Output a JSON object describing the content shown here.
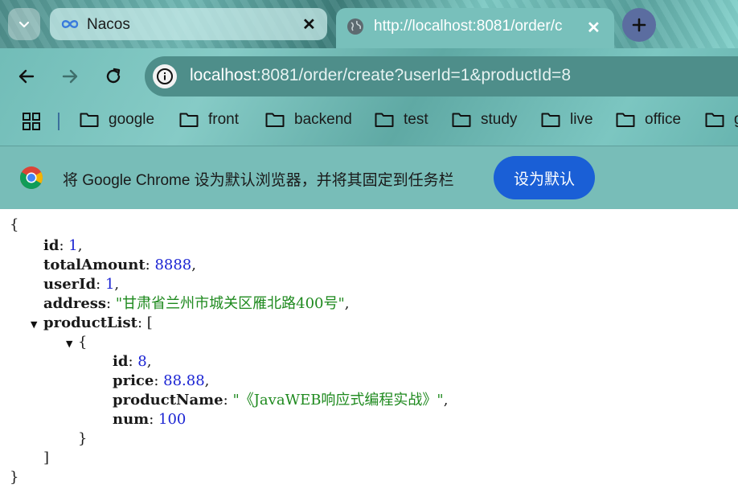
{
  "tabs": [
    {
      "title": "Nacos",
      "icon": "infinity-icon"
    },
    {
      "title": "http://localhost:8081/order/c",
      "icon": "globe-icon"
    }
  ],
  "omnibox": {
    "host": "localhost",
    "rest": ":8081/order/create?userId=1&productId=8"
  },
  "bookmarks": [
    {
      "label": "google"
    },
    {
      "label": "front"
    },
    {
      "label": "backend"
    },
    {
      "label": "test"
    },
    {
      "label": "study"
    },
    {
      "label": "live"
    },
    {
      "label": "office"
    },
    {
      "label": "g"
    }
  ],
  "infobar": {
    "message": "将 Google Chrome 设为默认浏览器，并将其固定到任务栏",
    "button_label": "设为默认"
  },
  "json_view": {
    "open_brace": "{",
    "close_brace": "}",
    "id_key": "id",
    "id_val": "1",
    "total_key": "totalAmount",
    "total_val": "8888",
    "user_key": "userId",
    "user_val": "1",
    "address_key": "address",
    "address_val": "\"甘肃省兰州市城关区雁北路400号\"",
    "list_key": "productList",
    "list_open": "[",
    "list_close": "]",
    "item_open": "{",
    "item_close": "}",
    "p_id_key": "id",
    "p_id_val": "8",
    "price_key": "price",
    "price_val": "88.88",
    "pname_key": "productName",
    "pname_val": "\"《JavaWEB响应式编程实战》\"",
    "num_key": "num",
    "num_val": "100"
  },
  "colors": {
    "json_number": "#1c25d3",
    "json_string": "#1f8a1f",
    "button": "#1a5fd6"
  }
}
